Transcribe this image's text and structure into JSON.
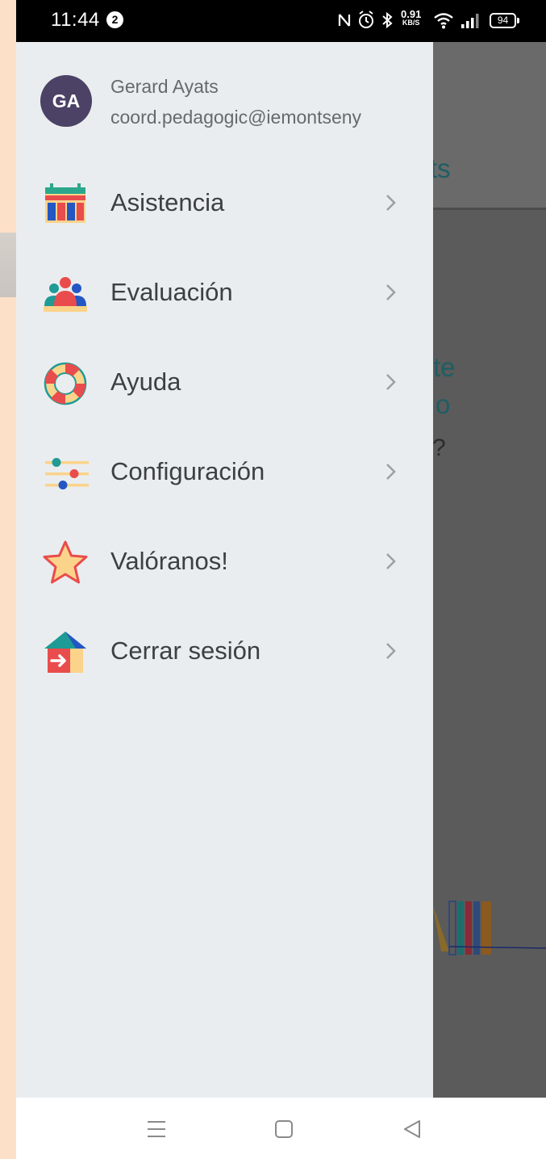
{
  "status_bar": {
    "time": "11:44",
    "notification_count": "2",
    "net_speed": "0.91",
    "net_speed_unit": "KB/S",
    "battery": "94"
  },
  "background_app": {
    "tab_fragment": "ts",
    "heading_line1": "te",
    "heading_line2": "o",
    "question_fragment": "?"
  },
  "drawer": {
    "avatar_initials": "GA",
    "user_name": "Gerard Ayats",
    "user_email": "coord.pedagogic@iemontseny",
    "items": [
      {
        "label": "Asistencia",
        "icon": "calendar-icon"
      },
      {
        "label": "Evaluación",
        "icon": "group-icon"
      },
      {
        "label": "Ayuda",
        "icon": "lifebuoy-icon"
      },
      {
        "label": "Configuración",
        "icon": "sliders-icon"
      },
      {
        "label": "Valóranos!",
        "icon": "star-icon"
      },
      {
        "label": "Cerrar sesión",
        "icon": "logout-icon"
      }
    ]
  },
  "nav_bar": {
    "buttons": [
      "menu-icon",
      "home-icon",
      "back-icon"
    ]
  },
  "colors": {
    "drawer_bg": "#eaedef",
    "scrim": "#5b5b5b",
    "avatar_bg": "#4b4266",
    "teal_accent": "#1e5e63"
  }
}
